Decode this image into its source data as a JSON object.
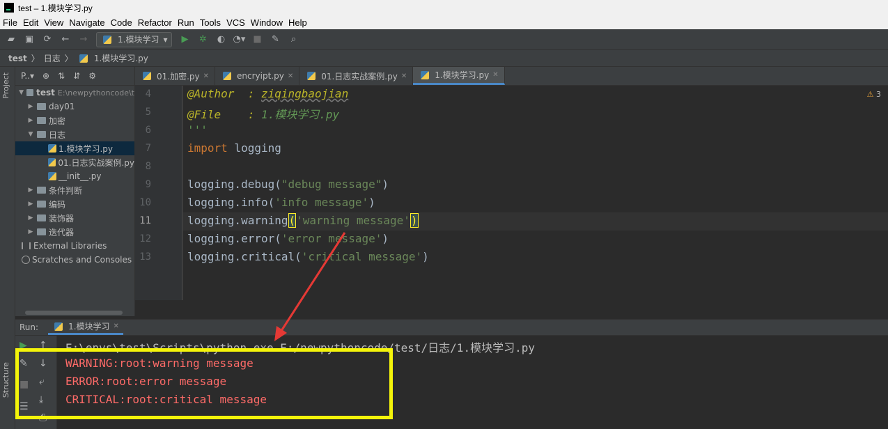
{
  "window": {
    "title": "test – 1.模块学习.py"
  },
  "menu": [
    "File",
    "Edit",
    "View",
    "Navigate",
    "Code",
    "Refactor",
    "Run",
    "Tools",
    "VCS",
    "Window",
    "Help"
  ],
  "toolbar": {
    "run_config": "1.模块学习"
  },
  "breadcrumb": [
    "test",
    "日志",
    "1.模块学习.py"
  ],
  "sidebar_tabs": {
    "project": "Project",
    "structure": "Structure"
  },
  "project": {
    "header": "P..▾",
    "root": {
      "name": "test",
      "path": "E:\\newpythoncode\\t"
    },
    "items": [
      {
        "label": "day01",
        "type": "folder"
      },
      {
        "label": "加密",
        "type": "folder"
      },
      {
        "label": "日志",
        "type": "folder-open"
      },
      {
        "label": "1.模块学习.py",
        "type": "py",
        "selected": true
      },
      {
        "label": "01.日志实战案例.py",
        "type": "py"
      },
      {
        "label": "__init__.py",
        "type": "py"
      },
      {
        "label": "条件判断",
        "type": "folder"
      },
      {
        "label": "编码",
        "type": "folder"
      },
      {
        "label": "装饰器",
        "type": "folder"
      },
      {
        "label": "迭代器",
        "type": "folder"
      },
      {
        "label": "External Libraries",
        "type": "lib"
      },
      {
        "label": "Scratches and Consoles",
        "type": "scratch"
      }
    ]
  },
  "tabs": [
    {
      "label": "01.加密.py",
      "active": false
    },
    {
      "label": "encryipt.py",
      "active": false
    },
    {
      "label": "01.日志实战案例.py",
      "active": false
    },
    {
      "label": "1.模块学习.py",
      "active": true
    }
  ],
  "editor": {
    "warnings": "3",
    "line_numbers": [
      "4",
      "5",
      "6",
      "7",
      "8",
      "9",
      "10",
      "11",
      "12",
      "13"
    ],
    "current_line": "11",
    "lines": {
      "l4a": "@Author  : ",
      "l4b": "ziqingbaojian",
      "l5a": "@File    : ",
      "l5b": "1.模块学习.py",
      "l6": "'''",
      "l7a": "import",
      "l7b": " logging",
      "l9a": "logging.debug(",
      "l9b": "\"debug message\"",
      "l9c": ")",
      "l10a": "logging.info(",
      "l10b": "'info message'",
      "l10c": ")",
      "l11a": "logging.warning",
      "l11b": "(",
      "l11c": "'warning message'",
      "l11d": ")",
      "l12a": "logging.error(",
      "l12b": "'error message'",
      "l12c": ")",
      "l13a": "logging.critical(",
      "l13b": "'critical message'",
      "l13c": ")"
    }
  },
  "run": {
    "label": "Run:",
    "tab": "1.模块学习",
    "command": "E:\\envs\\test\\Scripts\\python.exe E:/newpythoncode/test/日志/1.模块学习.py",
    "output": [
      "WARNING:root:warning message",
      "ERROR:root:error message",
      "CRITICAL:root:critical message"
    ]
  },
  "colors": {
    "highlight_box": "#f4f40a",
    "arrow": "#e53935",
    "error_text": "#ff6b68"
  }
}
